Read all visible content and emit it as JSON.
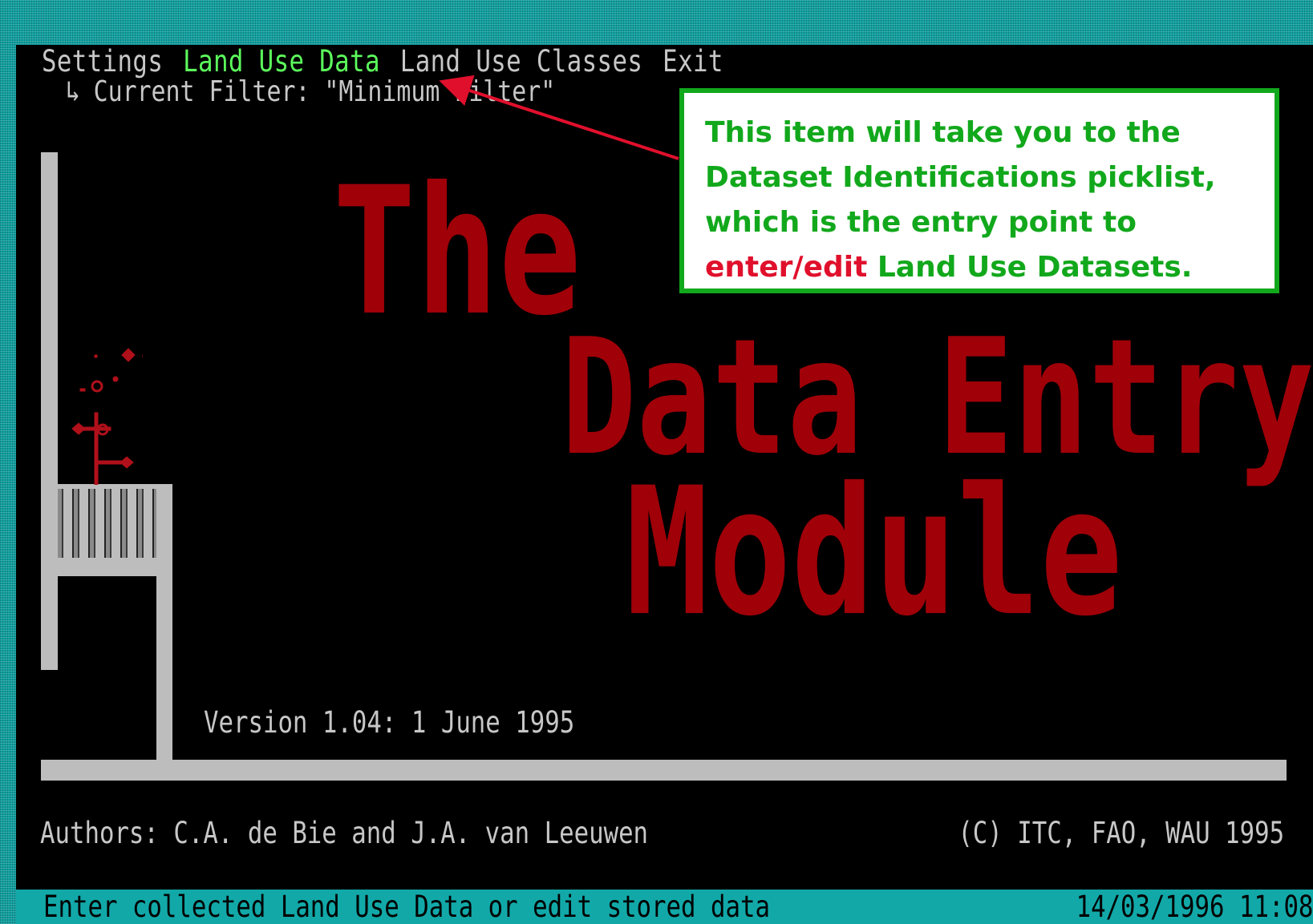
{
  "menu": {
    "items": [
      {
        "label": "Settings"
      },
      {
        "label": "Land Use Data"
      },
      {
        "label": "Land Use Classes"
      },
      {
        "label": "Exit"
      }
    ],
    "active_index": 1
  },
  "filter": {
    "arrow": "↳",
    "text": "Current Filter: \"Minimum Filter\""
  },
  "callout": {
    "part1": "This item will take you to the",
    "part2": "Dataset Identifications",
    "part3": " picklist,",
    "part4": "which is the entry point to",
    "part5": "enter/edit",
    "part6": " Land Use Datasets."
  },
  "splash": {
    "title_lines": [
      "The",
      "Data Entry",
      "Module"
    ],
    "title_color": "#a00008",
    "version": "Version 1.04: 1 June 1995",
    "authors": "Authors: C.A. de Bie and J.A. van Leeuwen",
    "copyright": "(C) ITC, FAO, WAU 1995"
  },
  "status": {
    "message": "Enter collected Land Use Data or edit stored data",
    "datetime": "14/03/1996 11:08"
  },
  "colors": {
    "desktop": "#0e9e9e",
    "menu_text": "#c7c7c7",
    "menu_active": "#5cfc5c",
    "callout_green": "#12a81c",
    "callout_red": "#e0102c",
    "status_bar": "#12a8a8"
  }
}
